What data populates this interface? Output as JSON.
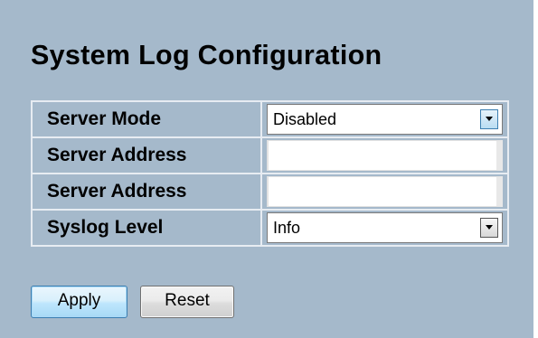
{
  "page": {
    "title": "System Log Configuration"
  },
  "form": {
    "server_mode": {
      "label": "Server Mode",
      "value": "Disabled"
    },
    "server_address_1": {
      "label": "Server Address",
      "value": ""
    },
    "server_address_2": {
      "label": "Server Address",
      "value": ""
    },
    "syslog_level": {
      "label": "Syslog Level",
      "value": "Info"
    }
  },
  "buttons": {
    "apply_label": "Apply",
    "reset_label": "Reset"
  },
  "icons": {
    "dropdown": "chevron-down-icon"
  },
  "colors": {
    "panel_background": "#a5b9cb",
    "grid_lines": "#e7ecf2",
    "apply_border": "#3c7fb1"
  }
}
